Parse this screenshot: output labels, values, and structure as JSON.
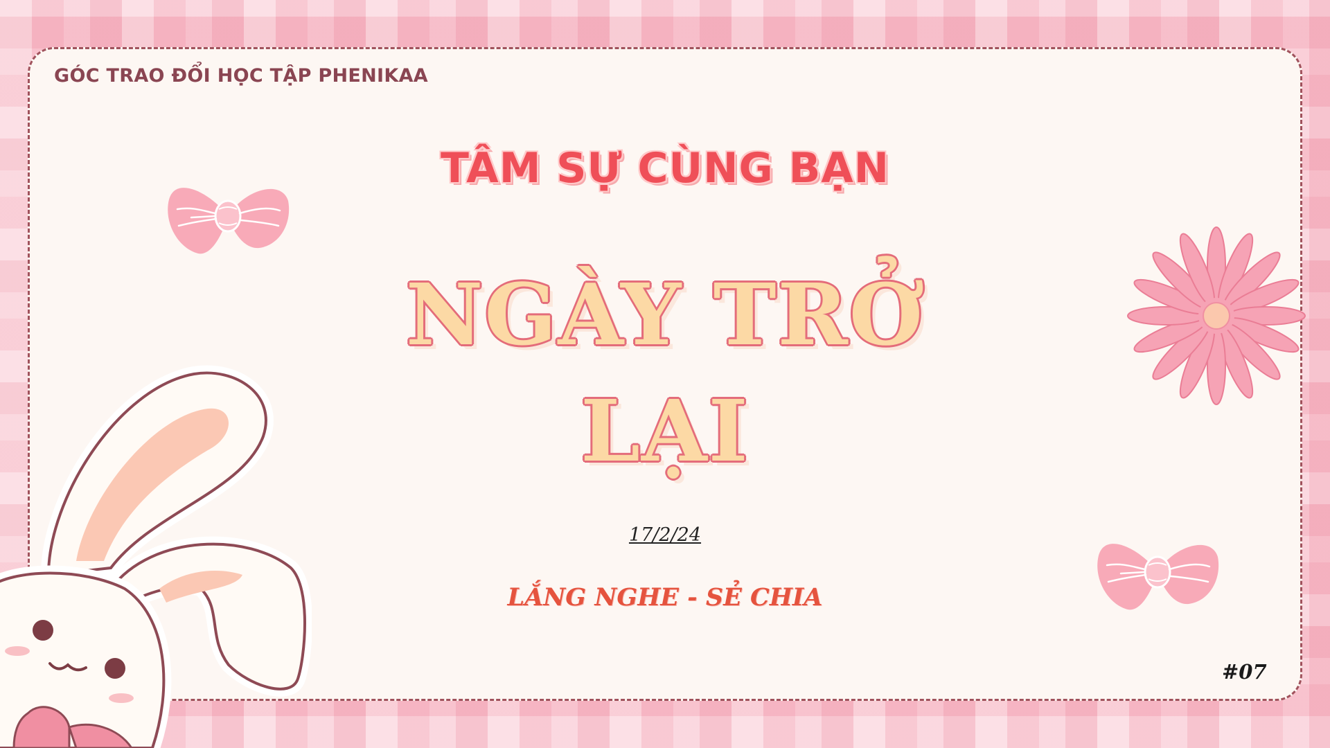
{
  "slide": {
    "brand": "GÓC TRAO ĐỔI HỌC TẬP PHENIKAA",
    "subtitle": "TÂM SỰ CÙNG BẠN",
    "title_line1": "NGÀY TRỞ",
    "title_line2": "LẠI",
    "date": "17/2/24",
    "tagline": "LẮNG NGHE - SẺ CHIA",
    "episode": "#07"
  },
  "decorations": {
    "icons": [
      "bow-icon",
      "flower-icon",
      "bunny-illustration"
    ]
  },
  "colors": {
    "card_background": "#fdf7f3",
    "card_border": "#a0525c",
    "brand_text": "#8a4552",
    "subtitle_red": "#ef4f58",
    "headline_fill": "#fcd9a5",
    "headline_outline": "#e46c7a",
    "tagline_red": "#e5533e",
    "pink_decoration": "#f6a3b5"
  }
}
